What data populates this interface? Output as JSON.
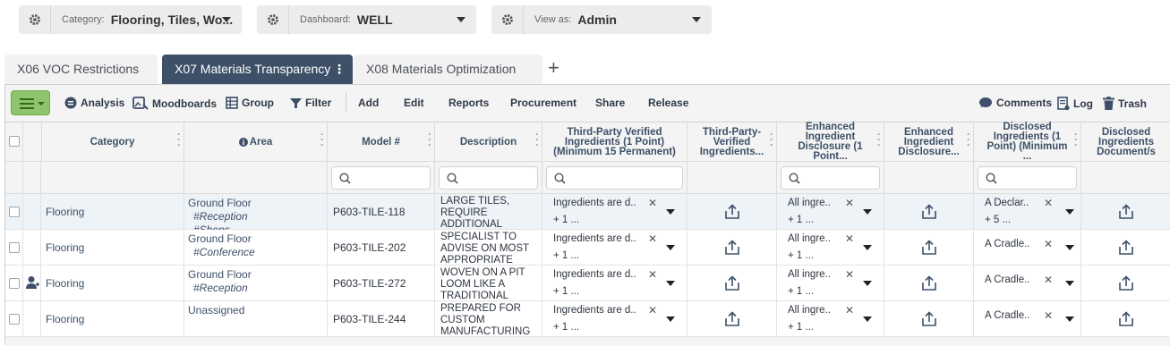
{
  "filters": {
    "category": {
      "label": "Category:",
      "value": "Flooring, Tiles, Wo..."
    },
    "dashboard": {
      "label": "Dashboard:",
      "value": "WELL"
    },
    "view": {
      "label": "View as:",
      "value": "Admin"
    }
  },
  "tabs": [
    {
      "label": "X06 VOC Restrictions"
    },
    {
      "label": "X07 Materials Transparency",
      "active": true
    },
    {
      "label": "X08 Materials Optimization"
    }
  ],
  "add_tab": "+",
  "toolbar": {
    "analysis": "Analysis",
    "moodboards": "Moodboards",
    "group": "Group",
    "filter": "Filter",
    "add": "Add",
    "edit": "Edit",
    "reports": "Reports",
    "procurement": "Procurement",
    "share": "Share",
    "release": "Release",
    "comments": "Comments",
    "log": "Log",
    "trash": "Trash"
  },
  "columns": {
    "category": "Category",
    "area": "Area",
    "model": "Model #",
    "description": "Description",
    "tpv": "Third-Party Verified Ingredients (1 Point) (Minimum 15 Permanent)",
    "tpv_doc": "Third-Party-Verified Ingredients...",
    "eid": "Enhanced Ingredient Disclosure (1 Point...",
    "eid_doc": "Enhanced Ingredient Disclosure...",
    "di": "Disclosed Ingredients (1 Point) (Minimum ...",
    "di_doc": "Disclosed Ingredients Document/s"
  },
  "rows": [
    {
      "category": "Flooring",
      "area": "Ground Floor",
      "tags": [
        "#Reception",
        "#Shops"
      ],
      "model": "P603-TILE-118",
      "desc": "Large tiles, require additional",
      "tpv": "Ingredients are d..",
      "tpv_more": "+ 1 ...",
      "eid": "All ingre..",
      "eid_more": "+ 1 ...",
      "di": "A Declar..",
      "di_more": "+ 5 ...",
      "user_icon": false
    },
    {
      "category": "Flooring",
      "area": "Ground Floor",
      "tags": [
        "#Conference"
      ],
      "model": "P603-TILE-202",
      "desc": "Specialist to advise on most appropriate",
      "tpv": "Ingredients are d..",
      "tpv_more": "+ 1 ...",
      "eid": "All ingre..",
      "eid_more": "+ 1 ...",
      "di": "A Cradle..",
      "di_more": "",
      "user_icon": false
    },
    {
      "category": "Flooring",
      "area": "Ground Floor",
      "tags": [
        "#Reception"
      ],
      "model": "P603-TILE-272",
      "desc": "Woven on a pit loom like a traditional",
      "tpv": "Ingredients are d..",
      "tpv_more": "+ 1 ...",
      "eid": "All ingre..",
      "eid_more": "+ 1 ...",
      "di": "A Cradle..",
      "di_more": "",
      "user_icon": true
    },
    {
      "category": "Flooring",
      "area": "Unassigned",
      "tags": [],
      "model": "P603-TILE-244",
      "desc": "Prepared for custom manufacturing",
      "tpv": "Ingredients are d..",
      "tpv_more": "+ 1 ...",
      "eid": "All ingre..",
      "eid_more": "+ 1 ...",
      "di": "A Cradle..",
      "di_more": "",
      "user_icon": false
    }
  ],
  "colors": {
    "accent": "#3d5068",
    "menu_green": "#8fc46c",
    "row_selected": "#eef3f7"
  }
}
